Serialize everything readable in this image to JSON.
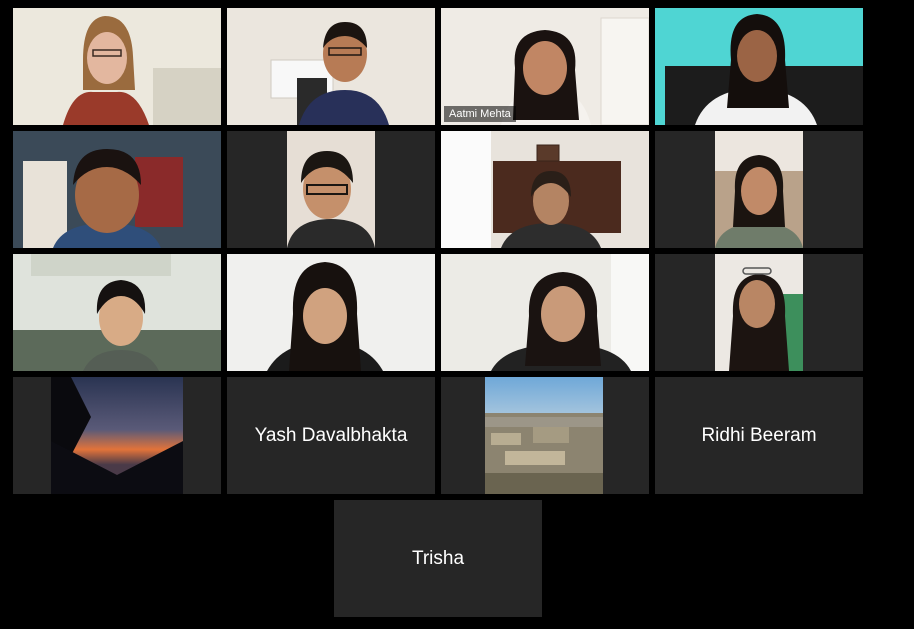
{
  "gallery": {
    "active_speaker": "Aatmi Mehta",
    "participants": [
      {
        "label": "",
        "kind": "video",
        "skin": "#e3b79f",
        "bg": "#eae7dd",
        "hair": "#9a6b3e",
        "shirt": "#8e3a2c"
      },
      {
        "label": "",
        "kind": "video",
        "skin": "#b77b55",
        "bg": "#ece8e2",
        "hair": "#1b1410",
        "shirt": "#2a3358"
      },
      {
        "label": "Aatmi Mehta",
        "kind": "video",
        "skin": "#c18664",
        "bg": "#f0ece6",
        "hair": "#1a1210",
        "shirt": "#f5f2ee"
      },
      {
        "label": "",
        "kind": "video",
        "skin": "#9b6445",
        "bg": "#4fd5d3",
        "hair": "#140e0c",
        "shirt": "#f2f2f2"
      },
      {
        "label": "",
        "kind": "video",
        "skin": "#a66a46",
        "bg": "#3b4a58",
        "hair": "#1a1210",
        "shirt": "#2f4e7a"
      },
      {
        "label": "",
        "kind": "video-pillar",
        "skin": "#c5906b",
        "bg": "#e6ded5",
        "hair": "#1b1612",
        "shirt": "#2a2a2a"
      },
      {
        "label": "",
        "kind": "video",
        "skin": "#b48463",
        "bg": "#e8e3dc",
        "hair": "#2a1f18",
        "shirt": "#2d2d2d"
      },
      {
        "label": "",
        "kind": "video-pillar",
        "skin": "#c18a68",
        "bg": "#ece6df",
        "hair": "#1b1410",
        "shirt": "#6f7c6a"
      },
      {
        "label": "",
        "kind": "video",
        "skin": "#d8ab86",
        "bg": "#dfe3dc",
        "hair": "#151110",
        "shirt": "#555e55"
      },
      {
        "label": "",
        "kind": "video",
        "skin": "#d0a27f",
        "bg": "#f0f0ee",
        "hair": "#17110e",
        "shirt": "#1b1b1b"
      },
      {
        "label": "",
        "kind": "video",
        "skin": "#c99a79",
        "bg": "#ecebe6",
        "hair": "#1a1311",
        "shirt": "#222222"
      },
      {
        "label": "",
        "kind": "video-pillar",
        "skin": "#b98664",
        "bg": "#ece8e3",
        "hair": "#1c1411",
        "shirt": "#3d8f5c"
      },
      {
        "label": "",
        "kind": "photo-sunset"
      },
      {
        "label": "Yash Davalbhakta",
        "kind": "name"
      },
      {
        "label": "",
        "kind": "photo-city"
      },
      {
        "label": "Ridhi Beeram",
        "kind": "name"
      },
      {
        "label": "Trisha",
        "kind": "name"
      }
    ]
  }
}
